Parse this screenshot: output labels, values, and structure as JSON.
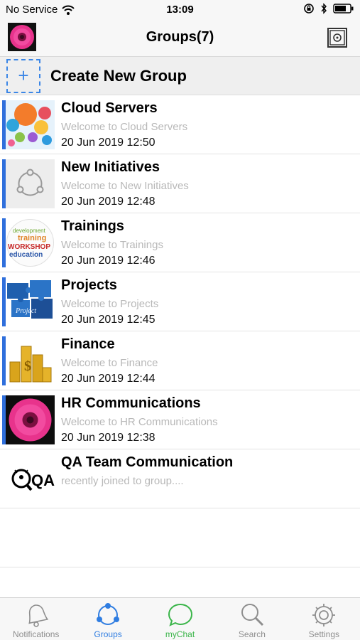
{
  "status_bar": {
    "carrier": "No Service",
    "time": "13:09"
  },
  "nav": {
    "title": "Groups(7)",
    "avatar_icon": "pink-flower-avatar",
    "action_icon": "safe-icon"
  },
  "create": {
    "plus": "+",
    "label": "Create New Group"
  },
  "groups": [
    {
      "name": "Cloud Servers",
      "message": "Welcome to Cloud Servers",
      "time": "20 Jun 2019 12:50",
      "unread": true,
      "thumb": "speech-bubbles"
    },
    {
      "name": "New Initiatives",
      "message": "Welcome to New Initiatives",
      "time": "20 Jun 2019 12:48",
      "unread": true,
      "thumb": "group-circle"
    },
    {
      "name": "Trainings",
      "message": "Welcome to Trainings",
      "time": "20 Jun 2019 12:46",
      "unread": true,
      "thumb": "word-cloud"
    },
    {
      "name": "Projects",
      "message": "Welcome to Projects",
      "time": "20 Jun 2019 12:45",
      "unread": true,
      "thumb": "puzzle"
    },
    {
      "name": "Finance",
      "message": "Welcome to Finance",
      "time": "20 Jun 2019 12:44",
      "unread": true,
      "thumb": "gold-coins"
    },
    {
      "name": "HR Communications",
      "message": "Welcome to HR Communications",
      "time": "20 Jun 2019 12:38",
      "unread": true,
      "thumb": "pink-flower"
    },
    {
      "name": "QA Team Communication",
      "message": "recently joined to group....",
      "time": "",
      "unread": false,
      "thumb": "qa-bug-logo"
    }
  ],
  "thumb_text": {
    "trainings_words": [
      "development",
      "training",
      "WORKSHOP",
      "education"
    ],
    "projects_word": "Project",
    "qa_logo": "QA"
  },
  "tabs": [
    {
      "label": "Notifications",
      "icon": "bell-icon",
      "active": false
    },
    {
      "label": "Groups",
      "icon": "groups-icon",
      "active": true
    },
    {
      "label": "myChat",
      "icon": "chat-bubble-icon",
      "active": false
    },
    {
      "label": "Search",
      "icon": "search-icon",
      "active": false
    },
    {
      "label": "Settings",
      "icon": "gear-icon",
      "active": false
    }
  ],
  "colors": {
    "accent": "#2f7de1",
    "unread_bar": "#2f6fdc",
    "chat_green": "#3bb54a",
    "subtitle_gray": "#b8b8b8"
  }
}
